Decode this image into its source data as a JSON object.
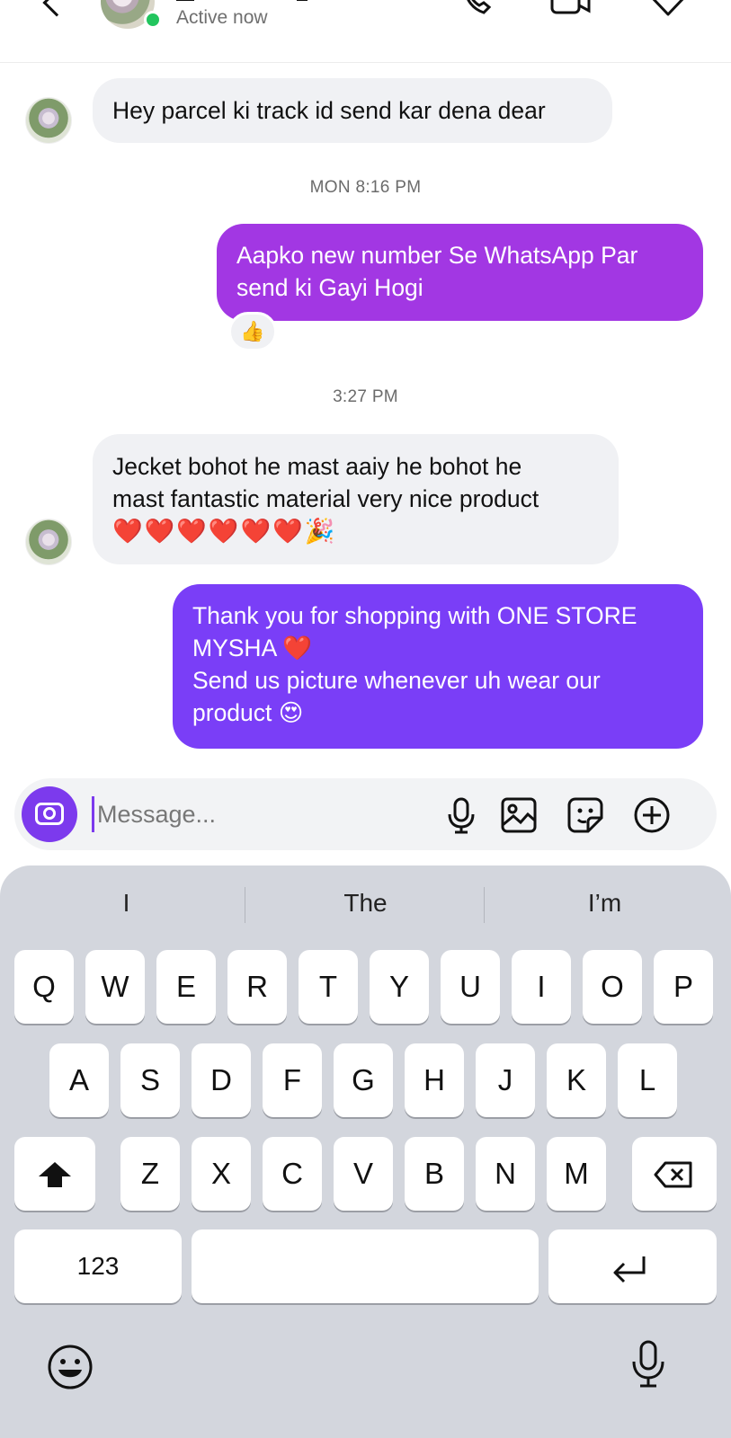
{
  "header": {
    "status": "Active now",
    "icons": [
      "back-icon",
      "call-icon",
      "video-icon",
      "heart-outline-icon"
    ]
  },
  "messages": [
    {
      "direction": "in",
      "text": "Hey parcel ki track id send kar dena dear"
    },
    {
      "type": "timestamp",
      "text": "MON 8:16 PM"
    },
    {
      "direction": "out",
      "lines": [
        "Aapko new number Se WhatsApp Par",
        "send ki Gayi Hogi"
      ],
      "reaction": "👍"
    },
    {
      "type": "timestamp",
      "text": "3:27 PM"
    },
    {
      "direction": "in",
      "lines": [
        "Jecket bohot he mast aaiy he bohot he",
        "mast fantastic material very nice product",
        "❤️❤️❤️❤️❤️❤️🎉"
      ]
    },
    {
      "direction": "out",
      "lines": [
        "Thank you for shopping with ONE STORE",
        "MYSHA ❤️",
        "Send us picture whenever uh wear our",
        "product 😍"
      ]
    }
  ],
  "composer": {
    "placeholder": "Message...",
    "icons": [
      "camera-icon",
      "microphone-icon",
      "gallery-icon",
      "sticker-icon",
      "add-icon"
    ]
  },
  "keyboard": {
    "suggestions": [
      "I",
      "The",
      "I’m"
    ],
    "row1": [
      "Q",
      "W",
      "E",
      "R",
      "T",
      "Y",
      "U",
      "I",
      "O",
      "P"
    ],
    "row2": [
      "A",
      "S",
      "D",
      "F",
      "G",
      "H",
      "J",
      "K",
      "L"
    ],
    "row3": [
      "Z",
      "X",
      "C",
      "V",
      "B",
      "N",
      "M"
    ],
    "numbers_key": "123",
    "icons": [
      "shift-icon",
      "backspace-icon",
      "return-icon",
      "emoji-icon",
      "dictation-icon"
    ]
  },
  "colors": {
    "accent": "#7c3aed",
    "out_bubble_1": "#a237e3",
    "out_bubble_2": "#7a3ef7",
    "in_bubble": "#f0f1f4",
    "online": "#22c55e",
    "keyboard_bg": "#d3d6dd"
  }
}
